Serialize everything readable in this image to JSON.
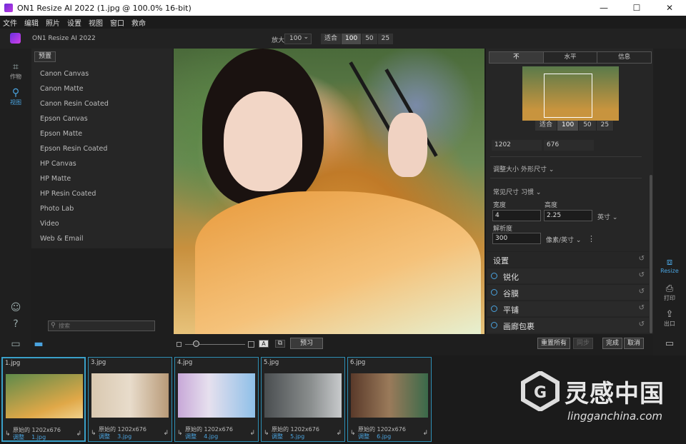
{
  "window": {
    "title": "ON1 Resize AI 2022 (1.jpg @ 100.0% 16-bit)",
    "minimize": "—",
    "maximize": "☐",
    "close": "✕"
  },
  "menu": [
    "文件",
    "编辑",
    "照片",
    "设置",
    "视图",
    "窗口",
    "救命"
  ],
  "toolbar": {
    "app_name": "ON1 Resize AI 2022",
    "zoom_label": "放大",
    "zoom_value": "100",
    "zoom_presets": [
      "适合",
      "100",
      "50",
      "25"
    ]
  },
  "left_rail": [
    {
      "label": "作物",
      "icon": "crop-icon"
    },
    {
      "label": "视图",
      "icon": "view-icon"
    }
  ],
  "presets": {
    "button": "预置",
    "items": [
      "Canon Canvas",
      "Canon Matte",
      "Canon Resin Coated",
      "Epson Canvas",
      "Epson Matte",
      "Epson Resin Coated",
      "HP Canvas",
      "HP Matte",
      "HP Resin Coated",
      "Photo Lab",
      "Video",
      "Web & Email"
    ],
    "search_placeholder": "搜索"
  },
  "image_bar": {
    "preview_button": "预习",
    "text_badge": "A"
  },
  "right_panel": {
    "tabs": [
      "不",
      "水平",
      "信息"
    ],
    "nav_zoom": [
      "适合",
      "100",
      "50",
      "25"
    ],
    "width_px": "1202",
    "height_px": "676",
    "resize_label": "调整大小",
    "resize_mode": "外形尺寸",
    "common_size_label": "常见尺寸",
    "common_size_value": "习惯",
    "width_label": "宽度",
    "height_label": "高度",
    "width_value": "4",
    "height_value": "2.25",
    "unit": "英寸",
    "resolution_label": "解析度",
    "resolution_value": "300",
    "resolution_unit": "像素/英寸",
    "more": "⋮",
    "settings_header": "设置",
    "sections": [
      "锐化",
      "谷膜",
      "平铺",
      "画廊包裹"
    ],
    "reset_icon": "↺"
  },
  "right_rail": [
    {
      "label": "Resize",
      "icon": "resize-ai-icon"
    },
    {
      "label": "打印",
      "icon": "printer-icon"
    },
    {
      "label": "出口",
      "icon": "export-icon"
    }
  ],
  "actions": {
    "reset_all": "重置所有",
    "sync": "同步",
    "done": "完成",
    "cancel": "取消"
  },
  "filmstrip": [
    {
      "name": "1.jpg",
      "meta": "原始的   1202x676",
      "adjust": "调整",
      "file": "1.jpg"
    },
    {
      "name": "3.jpg",
      "meta": "原始的   1202x676",
      "adjust": "调整",
      "file": "3.jpg"
    },
    {
      "name": "4.jpg",
      "meta": "原始的   1202x676",
      "adjust": "调整",
      "file": "4.jpg"
    },
    {
      "name": "5.jpg",
      "meta": "原始的   1202x676",
      "adjust": "调整",
      "file": "5.jpg"
    },
    {
      "name": "6.jpg",
      "meta": "原始的   1202x676",
      "adjust": "调整",
      "file": "6.jpg"
    }
  ],
  "watermark": {
    "cn": "灵感中国",
    "en": "lingganchina.com"
  }
}
